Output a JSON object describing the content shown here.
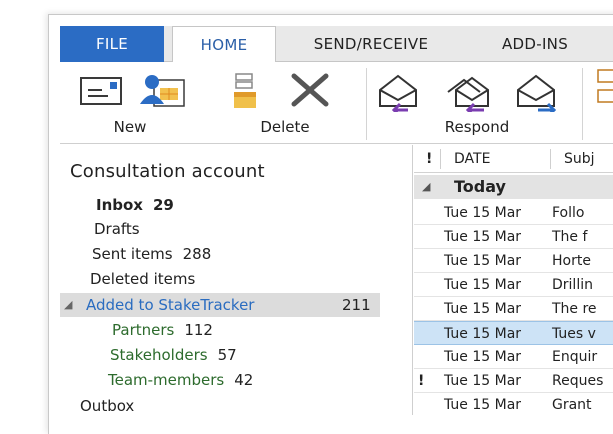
{
  "tabs": [
    {
      "label": "FILE"
    },
    {
      "label": "HOME"
    },
    {
      "label": "SEND/RECEIVE"
    },
    {
      "label": "ADD-INS"
    }
  ],
  "ribbon": {
    "new_label": "New",
    "delete_label": "Delete",
    "respond_label": "Respond"
  },
  "folders": {
    "account": "Consultation account",
    "items": [
      {
        "label": "Inbox",
        "count": "29"
      },
      {
        "label": "Drafts",
        "count": ""
      },
      {
        "label": "Sent items",
        "count": "288"
      },
      {
        "label": "Deleted items",
        "count": ""
      },
      {
        "label": "Added to StakeTracker",
        "count": "211"
      },
      {
        "label": "Partners",
        "count": "112"
      },
      {
        "label": "Stakeholders",
        "count": "57"
      },
      {
        "label": "Team-members",
        "count": "42"
      },
      {
        "label": "Outbox",
        "count": ""
      }
    ]
  },
  "list": {
    "col_flag": "!",
    "col_date": "DATE",
    "col_subject": "Subj",
    "group": "Today",
    "rows": [
      {
        "flag": "",
        "date": "Tue 15 Mar",
        "subject": "Follo"
      },
      {
        "flag": "",
        "date": "Tue 15 Mar",
        "subject": "The f"
      },
      {
        "flag": "",
        "date": "Tue 15 Mar",
        "subject": "Horte"
      },
      {
        "flag": "",
        "date": "Tue 15 Mar",
        "subject": "Drillin"
      },
      {
        "flag": "",
        "date": "Tue 15 Mar",
        "subject": "The re"
      },
      {
        "flag": "",
        "date": "Tue 15 Mar",
        "subject": "Tues v"
      },
      {
        "flag": "",
        "date": "Tue 15 Mar",
        "subject": "Enquir"
      },
      {
        "flag": "!",
        "date": "Tue 15 Mar",
        "subject": "Reques"
      },
      {
        "flag": "",
        "date": "Tue 15 Mar",
        "subject": "Grant"
      }
    ]
  },
  "colors": {
    "accent": "#2b6cc4",
    "subfolder_text": "#2d6b2d",
    "selected_row": "#cde3f6"
  }
}
